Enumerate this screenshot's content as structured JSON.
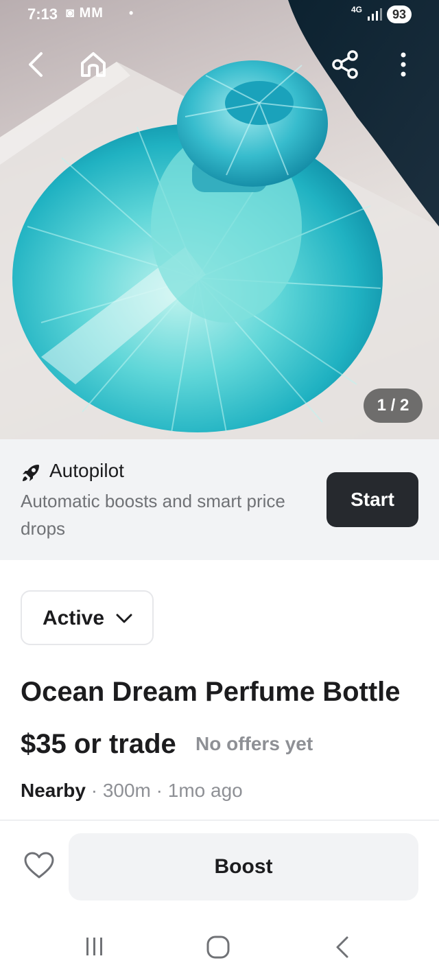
{
  "status_bar": {
    "time": "7:13",
    "notifications": "◙ MM",
    "dot": "•",
    "network": "4G",
    "battery": "93"
  },
  "gallery": {
    "counter": "1 / 2"
  },
  "autopilot": {
    "title": "Autopilot",
    "description": "Automatic boosts and smart price drops",
    "button_label": "Start"
  },
  "listing": {
    "status": "Active",
    "title": "Ocean Dream Perfume Bottle",
    "price": "$35 or trade",
    "offers": "No offers yet",
    "location": "Nearby",
    "distance": "· 300m · 1mo ago"
  },
  "actions": {
    "boost_label": "Boost"
  },
  "icons": {
    "back": "chevron-left-icon",
    "home": "home-icon",
    "share": "share-icon",
    "more": "more-vertical-icon",
    "heart": "heart-icon",
    "rocket": "rocket-icon"
  },
  "colors": {
    "primary_button": "#26292e",
    "banner_bg": "#f2f3f5",
    "muted_text": "#8e9095",
    "bottle_accent": "#2ab8c6"
  }
}
